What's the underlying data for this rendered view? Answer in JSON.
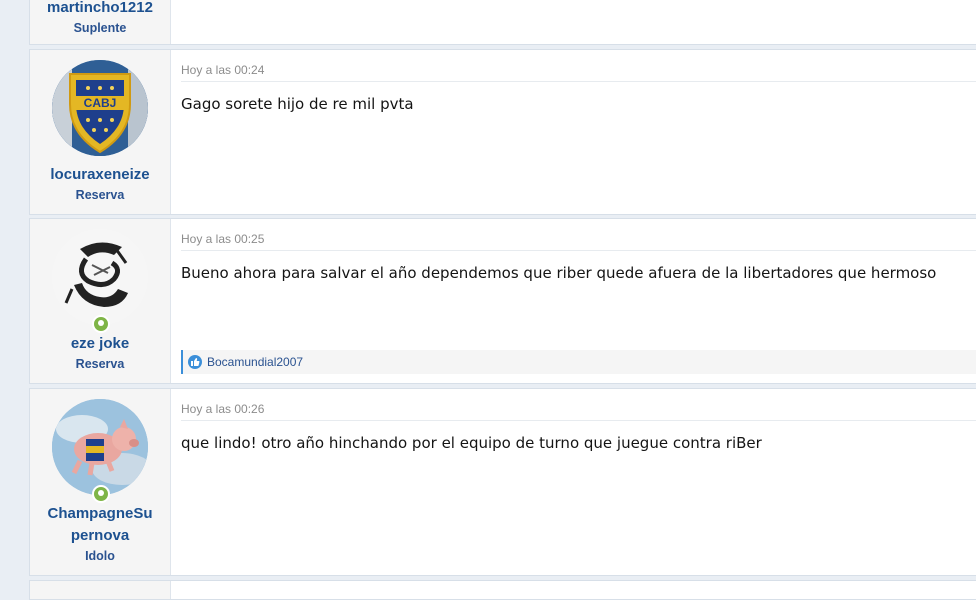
{
  "posts": [
    {
      "username": "martincho1212",
      "role": "Suplente"
    },
    {
      "username": "locuraxeneize",
      "role": "Reserva",
      "date": "Hoy a las 00:24",
      "text": "Gago sorete hijo de re mil pvta",
      "avatar": "cabj-crest-avatar"
    },
    {
      "username": "eze joke",
      "role": "Reserva",
      "date": "Hoy a las 00:25",
      "text": "Bueno ahora para salvar el año dependemos que riber quede afuera de la libertadores que hermoso",
      "reaction_user": "Bocamundial2007",
      "avatar": "graffiti-avatar"
    },
    {
      "username_line1": "ChampagneSu",
      "username_line2": "pernova",
      "role": "Idolo",
      "date": "Hoy a las 00:26",
      "text": "que lindo! otro año hinchando por el equipo de turno que juegue contra riBer",
      "avatar": "flying-pig-avatar"
    }
  ],
  "colors": {
    "username": "#1d5190",
    "online": "#7fb547",
    "like": "#3b8fd9"
  }
}
